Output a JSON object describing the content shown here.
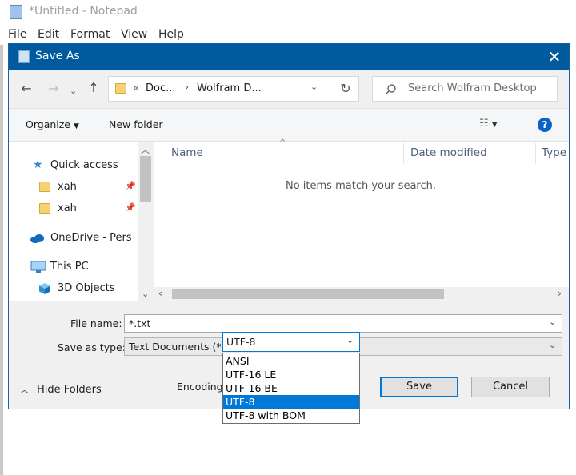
{
  "notepad": {
    "title": "*Untitled - Notepad",
    "menu": [
      "File",
      "Edit",
      "Format",
      "View",
      "Help"
    ]
  },
  "dialog": {
    "title": "Save As",
    "address": {
      "part1": "Doc...",
      "part2": "Wolfram D..."
    },
    "search_placeholder": "Search Wolfram Desktop",
    "toolbar": {
      "organize": "Organize",
      "new_folder": "New folder"
    },
    "nav": {
      "quick_access": "Quick access",
      "xah1": "xah",
      "xah2": "xah",
      "onedrive": "OneDrive - Pers",
      "this_pc": "This PC",
      "objects_3d": "3D Objects"
    },
    "columns": {
      "name": "Name",
      "date": "Date modified",
      "type": "Type"
    },
    "empty_message": "No items match your search.",
    "file_name_label": "File name:",
    "file_name_value": "*.txt",
    "save_type_label": "Save as type:",
    "save_type_value": "Text Documents (*.txt)",
    "hide_folders": "Hide Folders",
    "encoding_label": "Encoding:",
    "encoding_value": "UTF-8",
    "encoding_options": [
      "ANSI",
      "UTF-16 LE",
      "UTF-16 BE",
      "UTF-8",
      "UTF-8 with BOM"
    ],
    "encoding_selected": "UTF-8",
    "save_button": "Save",
    "cancel_button": "Cancel"
  },
  "colors": {
    "titlebar": "#005a9e",
    "accent": "#0078d7",
    "help_icon": "#0a64c8"
  },
  "icons": [
    "back-arrow-icon",
    "forward-arrow-icon",
    "up-arrow-icon",
    "refresh-icon",
    "search-icon",
    "view-options-icon",
    "help-icon",
    "star-icon",
    "folder-icon",
    "pin-icon",
    "cloud-icon",
    "computer-icon",
    "cube-icon",
    "chevron-down-icon",
    "close-icon"
  ]
}
